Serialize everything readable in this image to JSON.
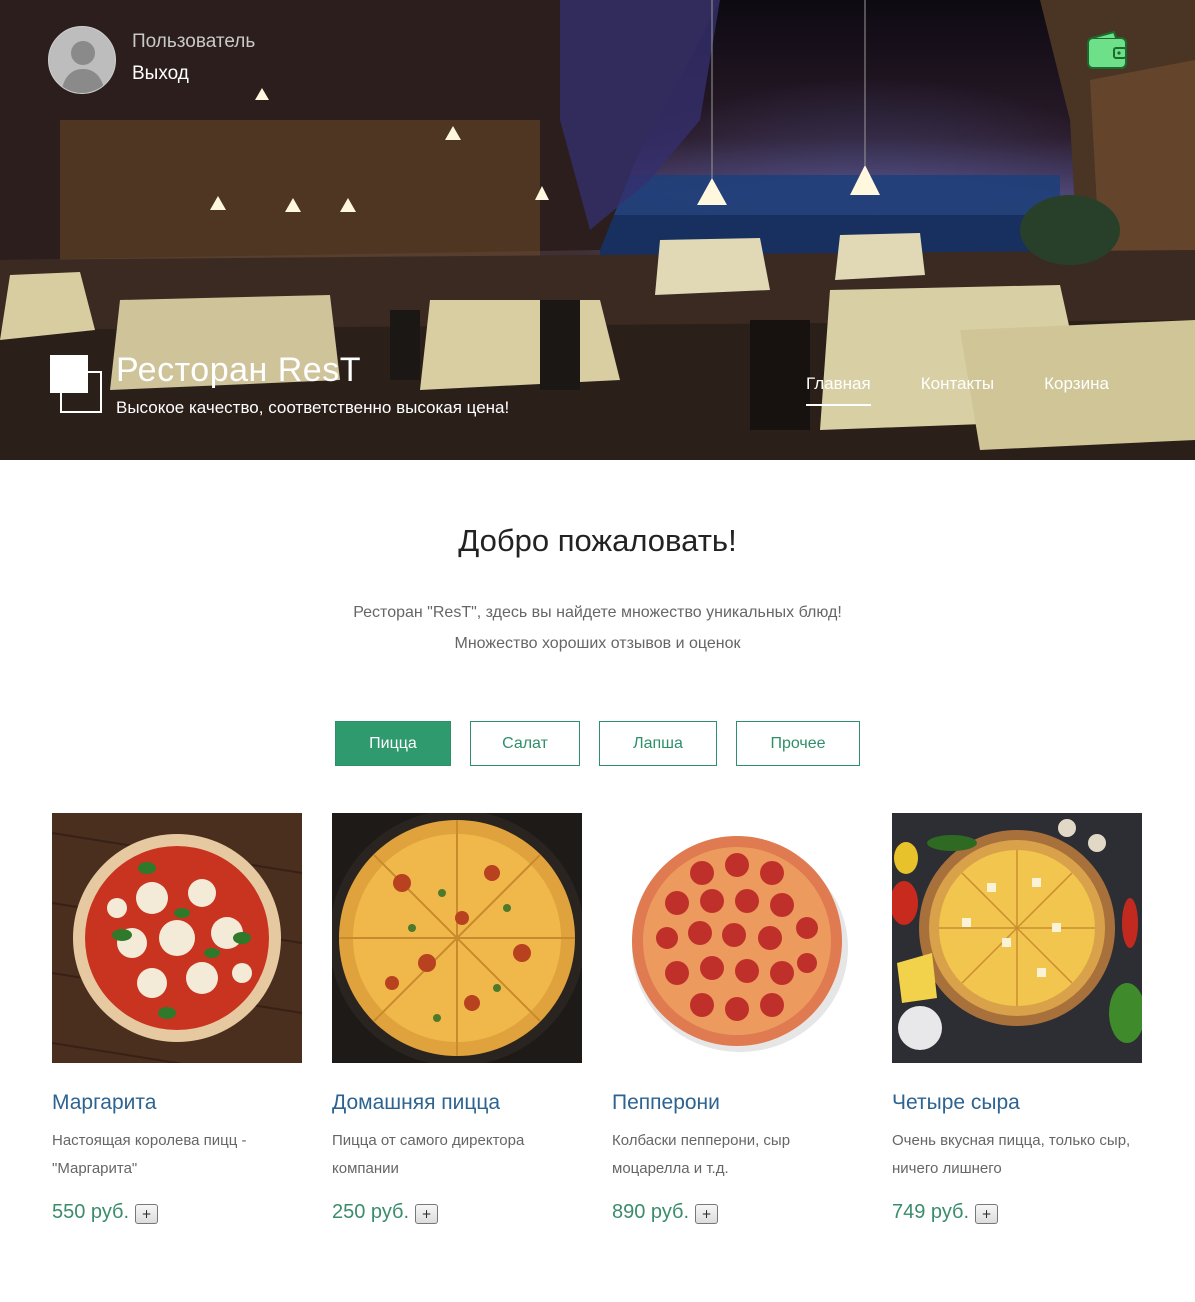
{
  "header": {
    "user_name": "Пользователь",
    "logout_label": "Выход",
    "brand_title": "Ресторан ResT",
    "brand_subtitle": "Высокое качество, соответственно высокая цена!",
    "nav": [
      {
        "label": "Главная",
        "active": true
      },
      {
        "label": "Контакты",
        "active": false
      },
      {
        "label": "Корзина",
        "active": false
      }
    ],
    "icons": {
      "avatar": "user-avatar-icon",
      "wallet": "wallet-icon",
      "logo": "brand-logo-icon"
    }
  },
  "welcome": {
    "title": "Добро пожаловать!",
    "line1": "Ресторан \"ResT\", здесь вы найдете множество уникальных блюд!",
    "line2": "Множество хороших отзывов и оценок"
  },
  "tabs": [
    {
      "label": "Пицца",
      "active": true
    },
    {
      "label": "Салат",
      "active": false
    },
    {
      "label": "Лапша",
      "active": false
    },
    {
      "label": "Прочее",
      "active": false
    }
  ],
  "products": [
    {
      "title": "Маргарита",
      "desc": "Настоящая королева пицц - \"Маргарита\"",
      "price": "550 руб.",
      "add": "+"
    },
    {
      "title": "Домашняя пицца",
      "desc": "Пицца от самого директора компании",
      "price": "250 руб.",
      "add": "+"
    },
    {
      "title": "Пепперони",
      "desc": "Колбаски пепперони, сыр моцарелла и т.д.",
      "price": "890 руб.",
      "add": "+"
    },
    {
      "title": "Четыре сыра",
      "desc": "Очень вкусная пицца, только сыр, ничего лишнего",
      "price": "749 руб.",
      "add": "+"
    }
  ],
  "colors": {
    "accent": "#2e9a6d",
    "title_blue": "#2d6391",
    "price_green": "#3a8c6a",
    "wallet_green": "#6fe08a"
  }
}
